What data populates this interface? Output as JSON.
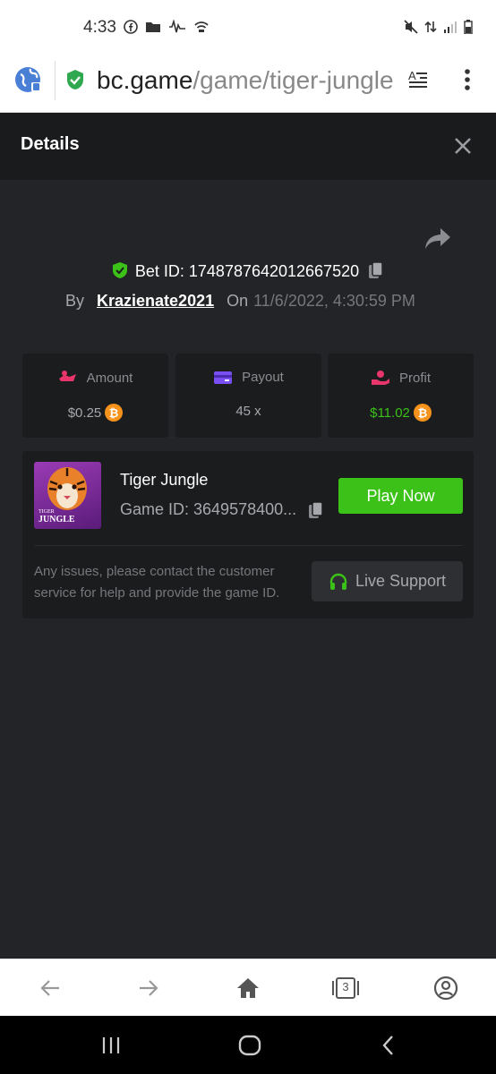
{
  "status_bar": {
    "time": "4:33"
  },
  "browser": {
    "url_domain": "bc.game",
    "url_path": "/game/tiger-jungle"
  },
  "details": {
    "title": "Details",
    "bet_id_label": "Bet ID: 1748787642012667520",
    "by_label": "By",
    "username": "Krazienate2021",
    "on_label": "On",
    "date": "11/6/2022, 4:30:59 PM"
  },
  "stats": [
    {
      "label": "Amount",
      "value": "$0.25"
    },
    {
      "label": "Payout",
      "value": "45 x"
    },
    {
      "label": "Profit",
      "value": "$11.02"
    }
  ],
  "game": {
    "name": "Tiger Jungle",
    "id_label": "Game ID: 3649578400...",
    "play_button": "Play Now",
    "thumb_text_1": "TIGER",
    "thumb_text_2": "JUNGLE",
    "issue_text": "Any issues, please contact the customer service for help and provide the game ID.",
    "support_button": "Live Support"
  },
  "bottom_bar": {
    "tab_count": "3"
  },
  "colors": {
    "accent_green": "#3bc117",
    "profit_green": "#3bc117",
    "amount_pink": "#e8356b",
    "payout_purple": "#7a4ff2",
    "profit_red": "#e8356b",
    "btc_orange": "#f7931a"
  }
}
